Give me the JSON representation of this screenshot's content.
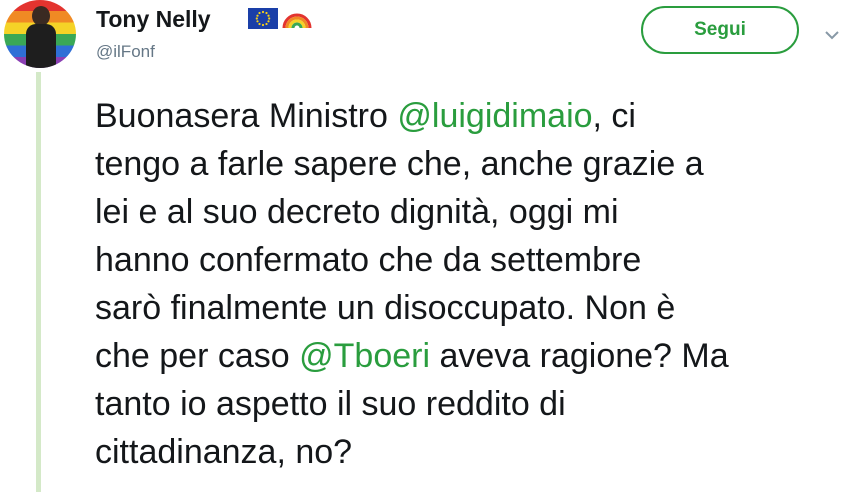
{
  "author": {
    "display_name": "Tony Nelly",
    "handle": "@ilFonf",
    "badges": [
      "eu-flag-icon",
      "rainbow-icon"
    ]
  },
  "actions": {
    "follow_label": "Segui",
    "more_icon": "chevron-down-icon"
  },
  "colors": {
    "accent": "#2a9d3e",
    "thread_line": "#d4e9c8",
    "text": "#14171a",
    "muted": "#657786"
  },
  "tweet": {
    "lines": [
      {
        "pre": "Buonasera Ministro ",
        "mention": "@luigidimaio",
        "post": ", ci"
      },
      {
        "pre": "tengo a farle sapere che, anche grazie a",
        "mention": "",
        "post": ""
      },
      {
        "pre": "lei e al suo decreto dignità, oggi mi",
        "mention": "",
        "post": ""
      },
      {
        "pre": "hanno confermato che da settembre",
        "mention": "",
        "post": ""
      },
      {
        "pre": "sarò finalmente un disoccupato. Non è",
        "mention": "",
        "post": ""
      },
      {
        "pre": "che per caso ",
        "mention": "@Tboeri",
        "post": " aveva ragione? Ma"
      },
      {
        "pre": "tanto io aspetto il suo reddito di",
        "mention": "",
        "post": ""
      },
      {
        "pre": "cittadinanza, no?",
        "mention": "",
        "post": ""
      }
    ]
  }
}
